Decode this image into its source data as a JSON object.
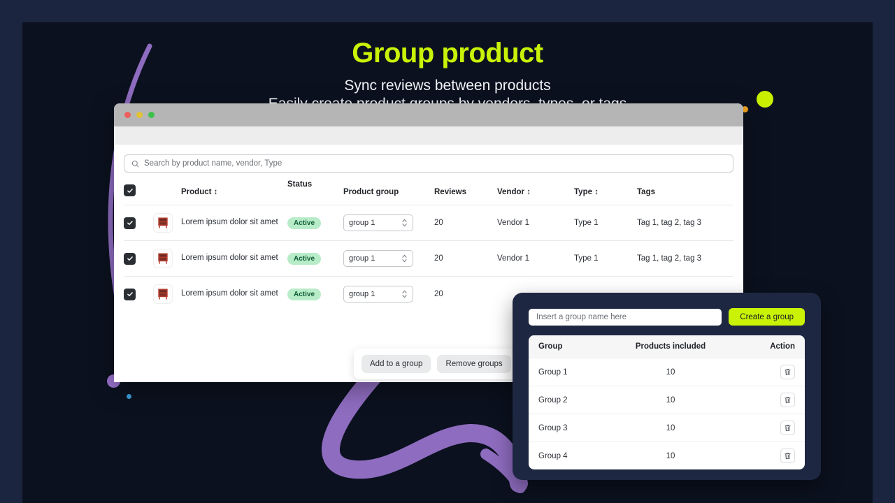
{
  "theme": {
    "accent_lime": "#c9f207",
    "canvas_bg": "#0b111f",
    "frame_bg": "#1b253f",
    "modal_bg": "#1e2742",
    "purple": "#9a72cc",
    "badge_bg": "#b8ecc9",
    "badge_fg": "#0e5b34"
  },
  "hero": {
    "title": "Group product",
    "subtitle_line1": "Sync reviews between products",
    "subtitle_line2": "Easily create product groups by vendors, types, or tags"
  },
  "window": {
    "traffic_lights": [
      "close",
      "minimize",
      "maximize"
    ],
    "search": {
      "placeholder": "Search by product name, vendor, Type",
      "icon": "search-icon"
    },
    "table": {
      "headers": [
        {
          "label": "Product",
          "sortable": true
        },
        {
          "label": "Status",
          "sortable": false
        },
        {
          "label": "Product group",
          "sortable": false
        },
        {
          "label": "Reviews",
          "sortable": false
        },
        {
          "label": "Vendor",
          "sortable": true
        },
        {
          "label": "Type",
          "sortable": true
        },
        {
          "label": "Tags",
          "sortable": false
        }
      ],
      "select_all_checked": true,
      "rows": [
        {
          "checked": true,
          "thumbnail": "bookshelf-thumbnail",
          "product": "Lorem ipsum dolor sit amet",
          "status": "Active",
          "group": "group 1",
          "reviews": "20",
          "vendor": "Vendor 1",
          "type": "Type 1",
          "tags": "Tag 1, tag 2, tag 3"
        },
        {
          "checked": true,
          "thumbnail": "bookshelf-thumbnail",
          "product": "Lorem ipsum dolor sit amet",
          "status": "Active",
          "group": "group 1",
          "reviews": "20",
          "vendor": "Vendor 1",
          "type": "Type 1",
          "tags": "Tag 1, tag 2, tag 3"
        },
        {
          "checked": true,
          "thumbnail": "bookshelf-thumbnail",
          "product": "Lorem ipsum dolor sit amet",
          "status": "Active",
          "group": "group 1",
          "reviews": "20",
          "vendor": "",
          "type": "",
          "tags": ""
        }
      ]
    },
    "action_bar": {
      "add_label": "Add to a group",
      "remove_label": "Remove groups"
    }
  },
  "modal": {
    "group_name_input": {
      "value": "",
      "placeholder": "Insert a group name here"
    },
    "create_button": "Create a group",
    "table": {
      "headers": [
        "Group",
        "Products included",
        "Action"
      ],
      "rows": [
        {
          "group": "Group 1",
          "products_included": "10",
          "action_icon": "trash-icon"
        },
        {
          "group": "Group 2",
          "products_included": "10",
          "action_icon": "trash-icon"
        },
        {
          "group": "Group 3",
          "products_included": "10",
          "action_icon": "trash-icon"
        },
        {
          "group": "Group 4",
          "products_included": "10",
          "action_icon": "trash-icon"
        }
      ]
    }
  }
}
